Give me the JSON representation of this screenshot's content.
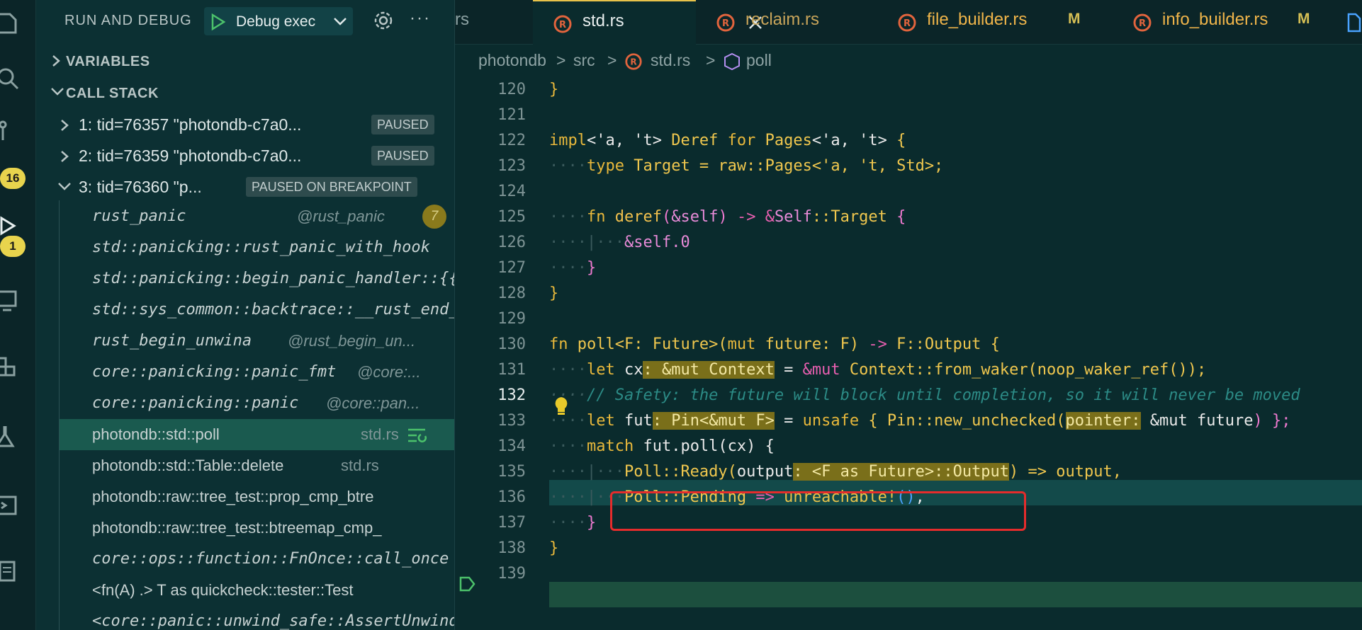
{
  "activity_bar": {
    "icons": [
      "explorer-icon",
      "search-icon",
      "source-control-icon",
      "run-debug-icon",
      "remote-explorer-icon",
      "extensions-icon",
      "testing-icon",
      "terminal-icon",
      "docs-icon"
    ],
    "badges": {
      "source_control": "16",
      "run_debug": "1"
    }
  },
  "sidebar": {
    "title": "RUN AND DEBUG",
    "config_name": "Debug exec",
    "variables_label": "VARIABLES",
    "call_stack_label": "CALL STACK",
    "threads": [
      {
        "label": "1: tid=76357 \"photondb-c7a0...",
        "state": "PAUSED"
      },
      {
        "label": "2: tid=76359 \"photondb-c7a0...",
        "state": "PAUSED"
      },
      {
        "label": "3: tid=76360 \"p...",
        "state": "PAUSED ON BREAKPOINT"
      }
    ],
    "frames": [
      {
        "fn": "rust_panic",
        "src": "@rust_panic",
        "count": "7"
      },
      {
        "fn": "std::panicking::rust_panic_with_hook",
        "src": ""
      },
      {
        "fn": "std::panicking::begin_panic_handler::{{",
        "src": ""
      },
      {
        "fn": "std::sys_common::backtrace::__rust_end_",
        "src": ""
      },
      {
        "fn": "rust_begin_unwina",
        "src": "@rust_begin_un..."
      },
      {
        "fn": "core::panicking::panic_fmt",
        "src": "@core:..."
      },
      {
        "fn": "core::panicking::panic",
        "src": "@core::pan..."
      },
      {
        "fn": "photondb::std::poll",
        "src": "std.rs"
      },
      {
        "fn": "photondb::std::Table::delete",
        "src": "std.rs"
      },
      {
        "fn": "photondb::raw::tree_test::prop_cmp_btre",
        "src": ""
      },
      {
        "fn": "photondb::raw::tree_test::btreemap_cmp_",
        "src": ""
      },
      {
        "fn": "core::ops::function::FnOnce::call_once",
        "src": ""
      },
      {
        "fn": "<fn(A) .> T as quickcheck::tester::Test",
        "src": ""
      },
      {
        "fn": "<core::panic::unwind_safe::AssertUnwind",
        "src": ""
      }
    ]
  },
  "tabs": [
    {
      "name": "rs",
      "modified": ""
    },
    {
      "name": "std.rs",
      "modified": ""
    },
    {
      "name": "reclaim.rs",
      "modified": ""
    },
    {
      "name": "file_builder.rs",
      "modified": "M"
    },
    {
      "name": "info_builder.rs",
      "modified": "M"
    }
  ],
  "breadcrumb": [
    "photondb",
    ">",
    "src",
    ">",
    "std.rs",
    ">",
    "poll"
  ],
  "code": {
    "line_numbers": [
      "120",
      "121",
      "122",
      "123",
      "124",
      "125",
      "126",
      "127",
      "128",
      "129",
      "130",
      "131",
      "132",
      "133",
      "134",
      "135",
      "136",
      "137",
      "138",
      "139"
    ],
    "current_line": "132",
    "breakpoint_line": "136",
    "l120": "}",
    "l122": [
      "impl",
      "<'a, 't>",
      " Deref ",
      "for",
      " Pages",
      "<'a, 't>",
      " {"
    ],
    "l123": [
      "type",
      " Target = raw::Pages<'a, 't, Std>;"
    ],
    "l125": [
      "fn",
      " deref",
      "(",
      "&self",
      ")",
      " -> ",
      "&",
      "Self",
      "::Target ",
      "{"
    ],
    "l126": "&self.0",
    "l127": "}",
    "l128": "}",
    "l130": [
      "fn",
      " poll<F: Future>(",
      "mut",
      " future: F) ",
      "->",
      " F::Output {"
    ],
    "l131": [
      "let",
      " cx",
      ": &mut Context",
      " = ",
      "&mut",
      " Context::from_waker(noop_waker_ref());"
    ],
    "l132": "// Safety: the future will block until completion, so it will never be moved",
    "l133": [
      "let",
      " fut",
      ": Pin<&mut F>",
      " = ",
      "unsafe",
      " { Pin::new_unchecked(",
      "pointer:",
      " &mut future",
      ") };"
    ],
    "l134": [
      "match",
      " fut.poll(cx) {"
    ],
    "l135": [
      "Poll::Ready(",
      "output",
      ": <F as Future>::Output",
      ") => output,"
    ],
    "l136": [
      "Poll::Pending",
      " => ",
      "unreachable!",
      "()",
      ","
    ],
    "l137": "}",
    "l138": "}"
  }
}
